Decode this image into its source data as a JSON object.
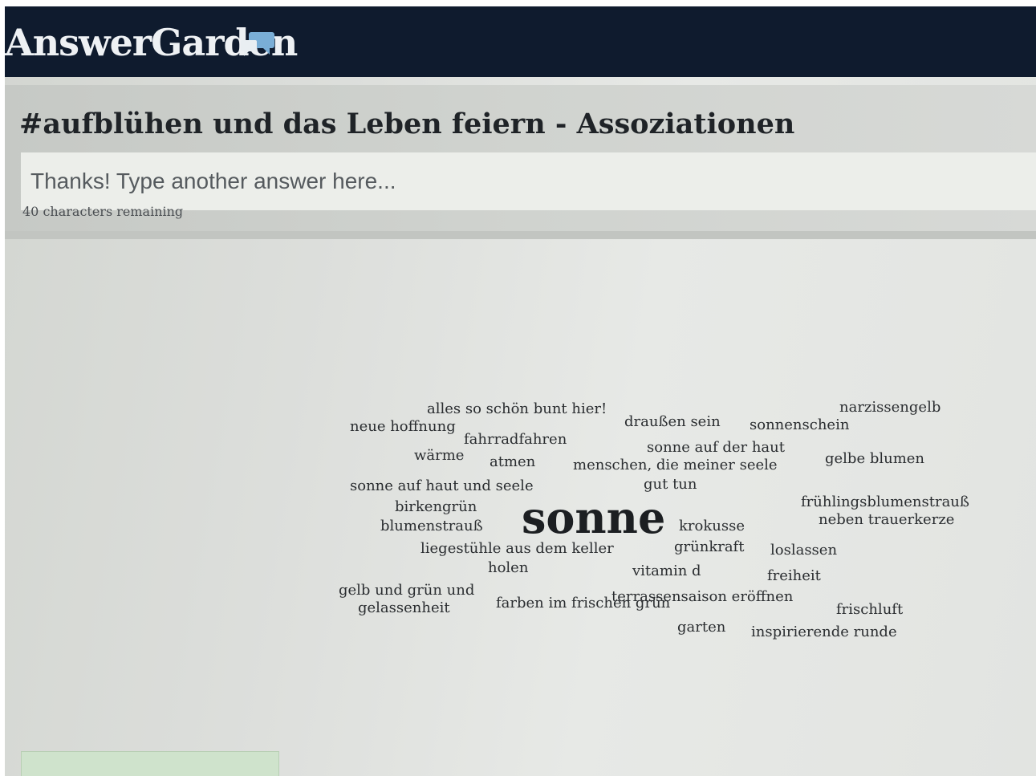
{
  "app": {
    "brand": "AnswerGarden",
    "brand_icon": "speech-bubbles-icon",
    "brand_color": "#0f1b2e",
    "icon_color": "#7aaed6"
  },
  "question": {
    "title": "#aufblühen und das Leben feiern - Assoziationen"
  },
  "answer_input": {
    "placeholder": "Thanks! Type another answer here...",
    "value": ""
  },
  "characters_remaining": "40 characters remaining",
  "word_cloud": [
    {
      "text": "alles so schön bunt hier!"
    },
    {
      "text": "draußen sein"
    },
    {
      "text": "sonnenschein"
    },
    {
      "text": "narzissengelb"
    },
    {
      "text": "neue hoffnung"
    },
    {
      "text": "fahrradfahren"
    },
    {
      "text": "sonne auf der haut"
    },
    {
      "text": "gelbe blumen"
    },
    {
      "text": "wärme"
    },
    {
      "text": "atmen"
    },
    {
      "text": "menschen, die meiner seele"
    },
    {
      "text": "gut tun"
    },
    {
      "text": "sonne auf haut und seele"
    },
    {
      "text": "frühlingsblumenstrauß"
    },
    {
      "text": "neben trauerkerze"
    },
    {
      "text": "birkengrün"
    },
    {
      "text": "sonne"
    },
    {
      "text": "blumenstrauß"
    },
    {
      "text": "krokusse"
    },
    {
      "text": "grünkraft"
    },
    {
      "text": "loslassen"
    },
    {
      "text": "liegestühle aus dem keller"
    },
    {
      "text": "holen"
    },
    {
      "text": "vitamin d"
    },
    {
      "text": "freiheit"
    },
    {
      "text": "gelb und grün und"
    },
    {
      "text": "gelassenheit"
    },
    {
      "text": "farben im frischen grün"
    },
    {
      "text": "terrassensaison eröffnen"
    },
    {
      "text": "frischluft"
    },
    {
      "text": "garten"
    },
    {
      "text": "inspirierende runde"
    }
  ]
}
